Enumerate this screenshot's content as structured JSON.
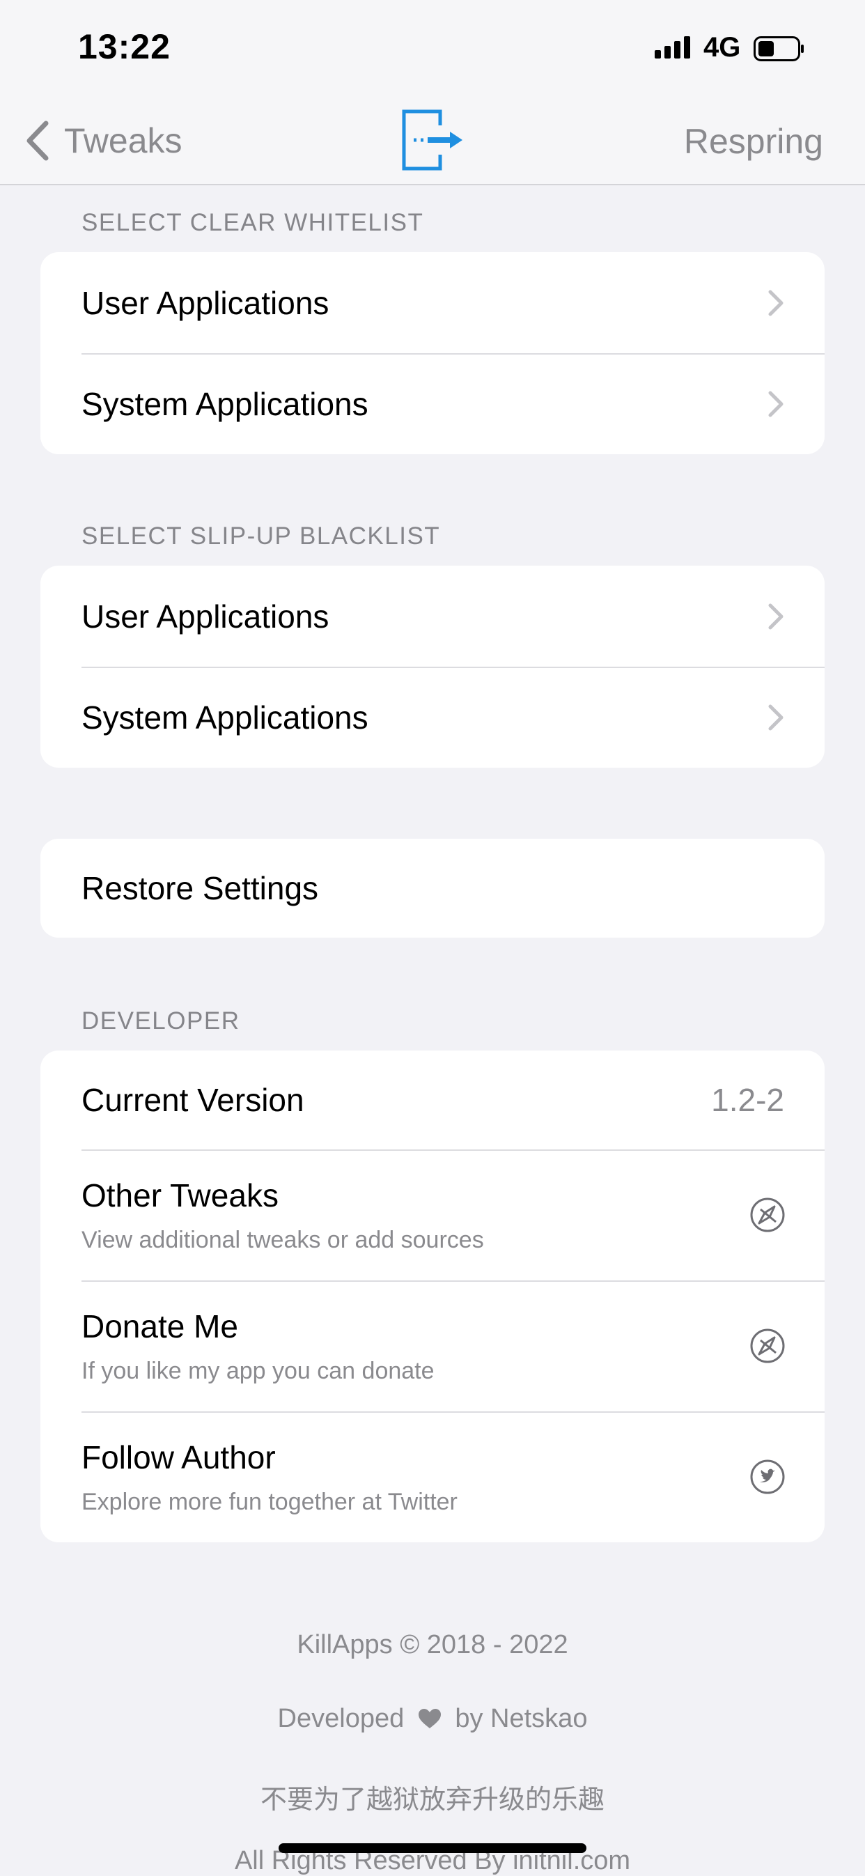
{
  "status_bar": {
    "time": "13:22",
    "network": "4G",
    "signal_icon": "cellular-signal-icon",
    "battery_icon": "battery-icon"
  },
  "nav": {
    "back_label": "Tweaks",
    "back_icon": "chevron-left-icon",
    "app_icon": "exit-arrow-app-icon",
    "respring_label": "Respring"
  },
  "sections": {
    "clear_whitelist": {
      "header": "SELECT CLEAR WHITELIST",
      "items": [
        {
          "label": "User Applications"
        },
        {
          "label": "System Applications"
        }
      ]
    },
    "slipup_blacklist": {
      "header": "SELECT SLIP-UP BLACKLIST",
      "items": [
        {
          "label": "User Applications"
        },
        {
          "label": "System Applications"
        }
      ]
    },
    "restore": {
      "label": "Restore Settings"
    },
    "developer": {
      "header": "DEVELOPER",
      "version_label": "Current Version",
      "version_value": "1.2-2",
      "items": [
        {
          "label": "Other Tweaks",
          "subtitle": "View additional tweaks or add sources",
          "icon": "compass-icon"
        },
        {
          "label": "Donate Me",
          "subtitle": "If you like my app you can donate",
          "icon": "compass-icon"
        },
        {
          "label": "Follow Author",
          "subtitle": "Explore more fun together at Twitter",
          "icon": "twitter-icon"
        }
      ]
    }
  },
  "footer": {
    "copyright": "KillApps © 2018 - 2022",
    "developed_prefix": "Developed",
    "developed_suffix": "by Netskao",
    "slogan": "不要为了越狱放弃升级的乐趣",
    "rights": "All Rights Reserved By initnil.com"
  },
  "colors": {
    "background": "#f2f2f6",
    "accent_blue": "#1f8fe0",
    "secondary_text": "#8a8a8e"
  }
}
